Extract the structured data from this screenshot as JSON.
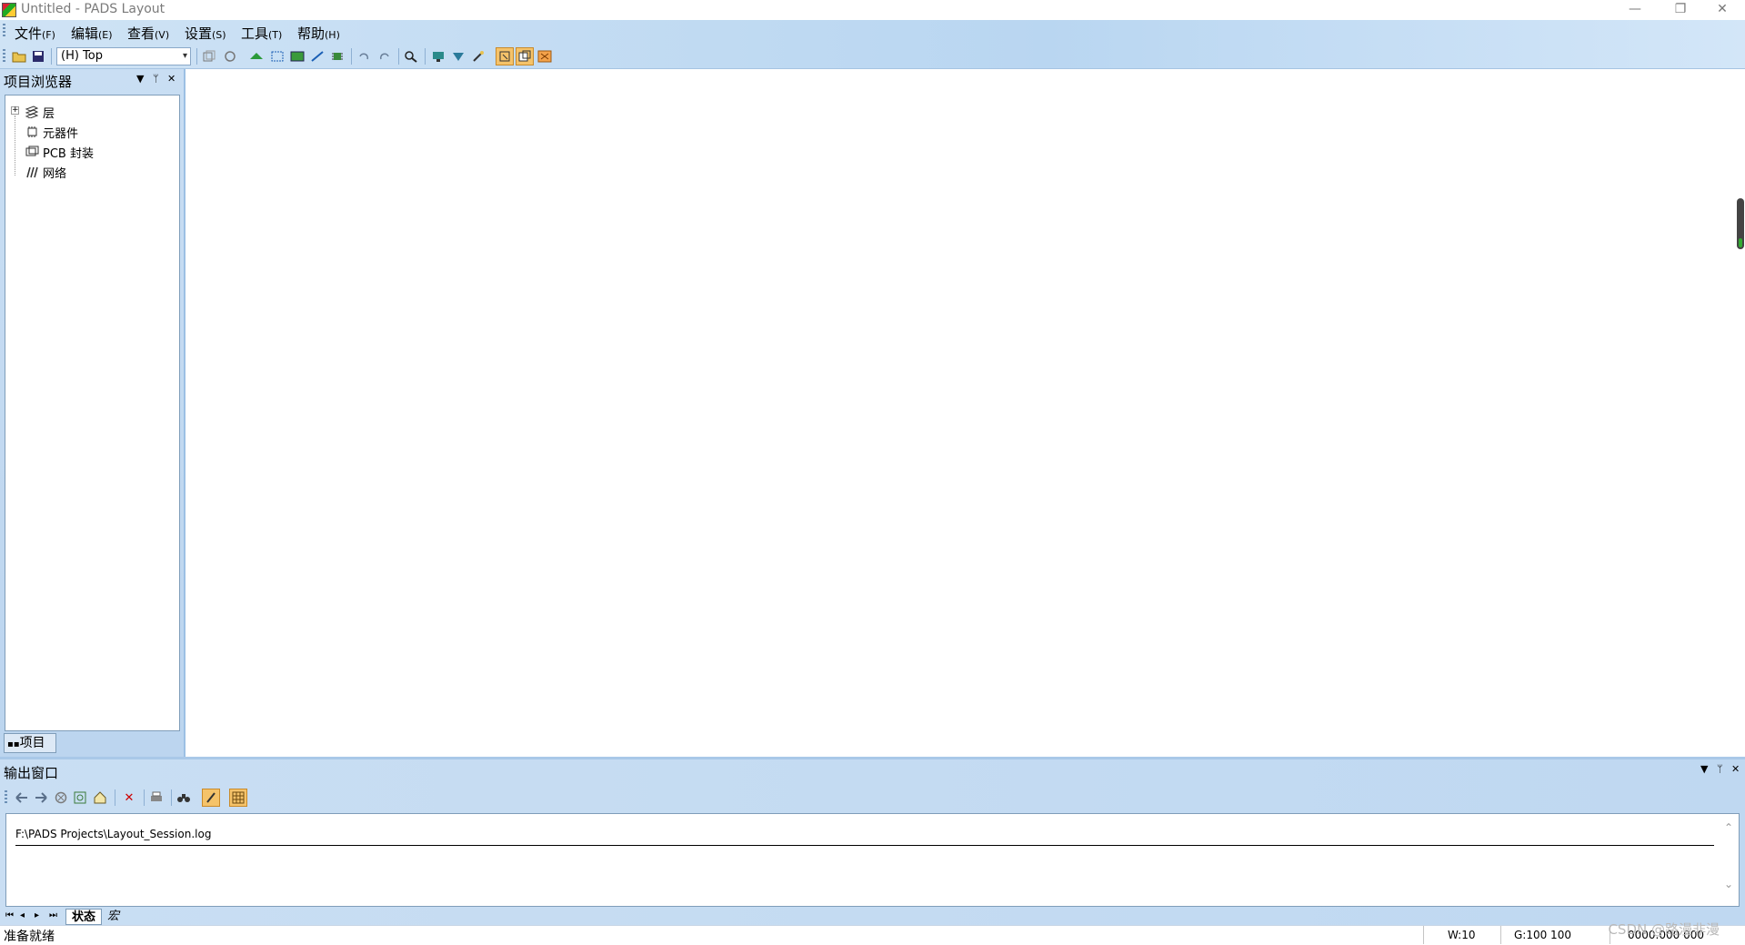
{
  "window": {
    "title": "Untitled - PADS Layout",
    "minimize": "—",
    "restore": "❐",
    "close": "✕"
  },
  "menu": [
    {
      "label": "文件",
      "key": "(F)"
    },
    {
      "label": "编辑",
      "key": "(E)"
    },
    {
      "label": "查看",
      "key": "(V)"
    },
    {
      "label": "设置",
      "key": "(S)"
    },
    {
      "label": "工具",
      "key": "(T)"
    },
    {
      "label": "帮助",
      "key": "(H)"
    }
  ],
  "toolbar": {
    "layer_select": "(H) Top"
  },
  "project_browser": {
    "title": "项目浏览器",
    "items": [
      "层",
      "元器件",
      "PCB 封装",
      "网络"
    ],
    "tab_label": "项目"
  },
  "output_window": {
    "title": "输出窗口",
    "log_path": "F:\\PADS Projects\\Layout_Session.log",
    "tabs": [
      "状态",
      "宏"
    ]
  },
  "status_bar": {
    "text": "准备就绪",
    "width": "W:10",
    "grid": "G:100 100",
    "coords": "0000.000  000"
  },
  "watermark": "CSDN @路漫非漫",
  "colors": {
    "panel_blue": "#bcd5ef",
    "border_blue": "#7f9db9"
  }
}
